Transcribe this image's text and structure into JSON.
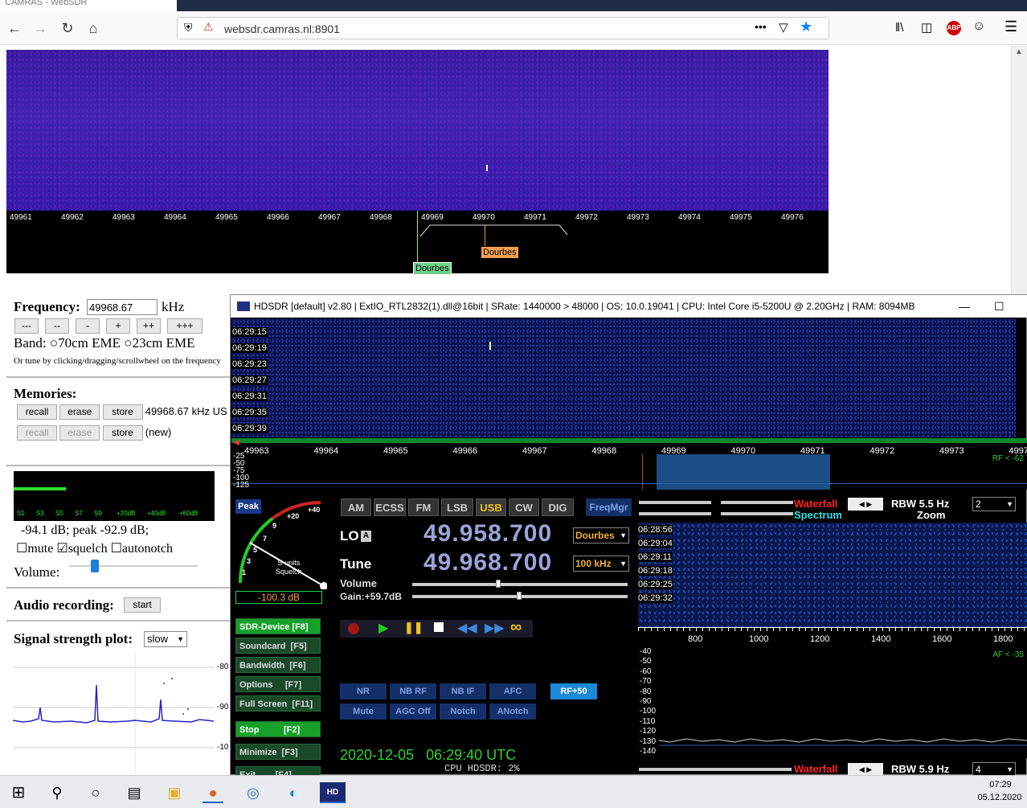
{
  "browser": {
    "tab_title": "CAMRAS - WebSDR",
    "url": "websdr.camras.nl:8901",
    "url_port_color": "#777"
  },
  "websdr": {
    "scale_ticks": [
      "49961",
      "49962",
      "49963",
      "49964",
      "49965",
      "49966",
      "49967",
      "49968",
      "49969",
      "49970",
      "49971",
      "49972",
      "49973",
      "49974",
      "49975",
      "49976"
    ],
    "marker_station": "Dourbes",
    "marker_tuned": "Dourbes",
    "frequency_label": "Frequency:",
    "frequency_value": "49968.67",
    "frequency_unit": "kHz",
    "step_buttons": [
      "---",
      "--",
      "-",
      "+",
      "++",
      "+++"
    ],
    "band_label": "Band:",
    "band_options": [
      "70cm EME",
      "23cm EME"
    ],
    "tune_hint": "Or tune by clicking/dragging/scrollwheel on the frequency",
    "memories_label": "Memories:",
    "memory_rows": [
      {
        "recall": "recall",
        "erase": "erase",
        "store": "store",
        "value": "49968.67 kHz US"
      },
      {
        "recall": "recall",
        "erase": "erase",
        "store": "store",
        "value": "(new)"
      }
    ],
    "smeter_labels": [
      "S1",
      "S3",
      "S5",
      "S7",
      "S9",
      "+20dB",
      "+40dB",
      "+60dB"
    ],
    "smeter_level": 0.25,
    "db_readout": "-94.1 dB; peak  -92.9 dB;",
    "checkbox_mute": "mute",
    "checkbox_squelch": "squelch",
    "checkbox_autonotch": "autonotch",
    "volume_label": "Volume:",
    "audio_label": "Audio recording:",
    "audio_start": "start",
    "signal_label": "Signal strength plot:",
    "signal_speed": "slow",
    "plot_labels": [
      "-80",
      "-90",
      "-10"
    ]
  },
  "hdsdr": {
    "title": "HDSDR  [default]  v2.80   |  ExtIO_RTL2832(1).dll@16bit  |  SRate: 1440000 > 48000  |  OS: 10.0.19041  |  CPU: Intel Core i5-5200U @ 2.20GHz  |  RAM: 8094MB",
    "times": [
      "06:29:15",
      "06:29:19",
      "06:29:23",
      "06:29:27",
      "06:29:31",
      "06:29:35",
      "06:29:39"
    ],
    "scale": [
      "49963",
      "49964",
      "49965",
      "49966",
      "49967",
      "49968",
      "49969",
      "49970",
      "49971",
      "49972",
      "49973",
      "4997"
    ],
    "db_labels": [
      "-25",
      "-50",
      "-75",
      "-100",
      "-125"
    ],
    "rf_label": "RF < -62",
    "peak": "Peak",
    "meter_ticks": [
      "+40",
      "+20",
      "9",
      "7",
      "5",
      "3",
      "1"
    ],
    "meter_caption": "S-units\nSquelch",
    "meter_value": "-100.3 dB",
    "modes": [
      "AM",
      "ECSS",
      "FM",
      "LSB",
      "USB",
      "CW",
      "DIG"
    ],
    "active_mode": "USB",
    "freqmgr": "FreqMgr",
    "lo_label": "LO",
    "lo_badge": "A",
    "lo_freq": "49.958.700",
    "lo_select": "Dourbes",
    "tune_label": "Tune",
    "tune_freq": "49.968.700",
    "tune_select": "100 kHz",
    "volume": "Volume",
    "gain": "Gain:+59.7dB",
    "side_buttons": [
      "SDR-Device [F8]",
      "Soundcard  [F5]",
      "Bandwidth  [F6]",
      "Options     [F7]",
      "Full Screen  [F11]",
      "Stop          [F2]",
      "Minimize  [F3]",
      "Exit        [F4]"
    ],
    "dsp_row1": [
      "NR",
      "NB RF",
      "NB IF",
      "AFC",
      "RF+50"
    ],
    "dsp_row2": [
      "Mute",
      "AGC Off",
      "Notch",
      "ANotch"
    ],
    "datetime": "2020-12-05   06:29:40 UTC",
    "cpu": "CPU HDSDR: 2%",
    "waterfall": "Waterfall",
    "spectrum": "Spectrum",
    "zoom": "Zoom",
    "rbw1": "RBW  5.5 Hz",
    "rbw1_sel": "2",
    "rbw2": "RBW  5.9 Hz",
    "rbw2_sel": "4",
    "af_times": [
      "06:28:56",
      "06:29:04",
      "06:29:11",
      "06:29:18",
      "06:29:25",
      "06:29:32"
    ],
    "af_scale": [
      "800",
      "1000",
      "1200",
      "1400",
      "1600",
      "1800"
    ],
    "af_db": [
      "-40",
      "-50",
      "-60",
      "-70",
      "-80",
      "-90",
      "-100",
      "-110",
      "-120",
      "-130",
      "-140"
    ],
    "af_label": "AF < -35"
  },
  "taskbar": {
    "time": "07:29",
    "date": "05.12.2020"
  }
}
